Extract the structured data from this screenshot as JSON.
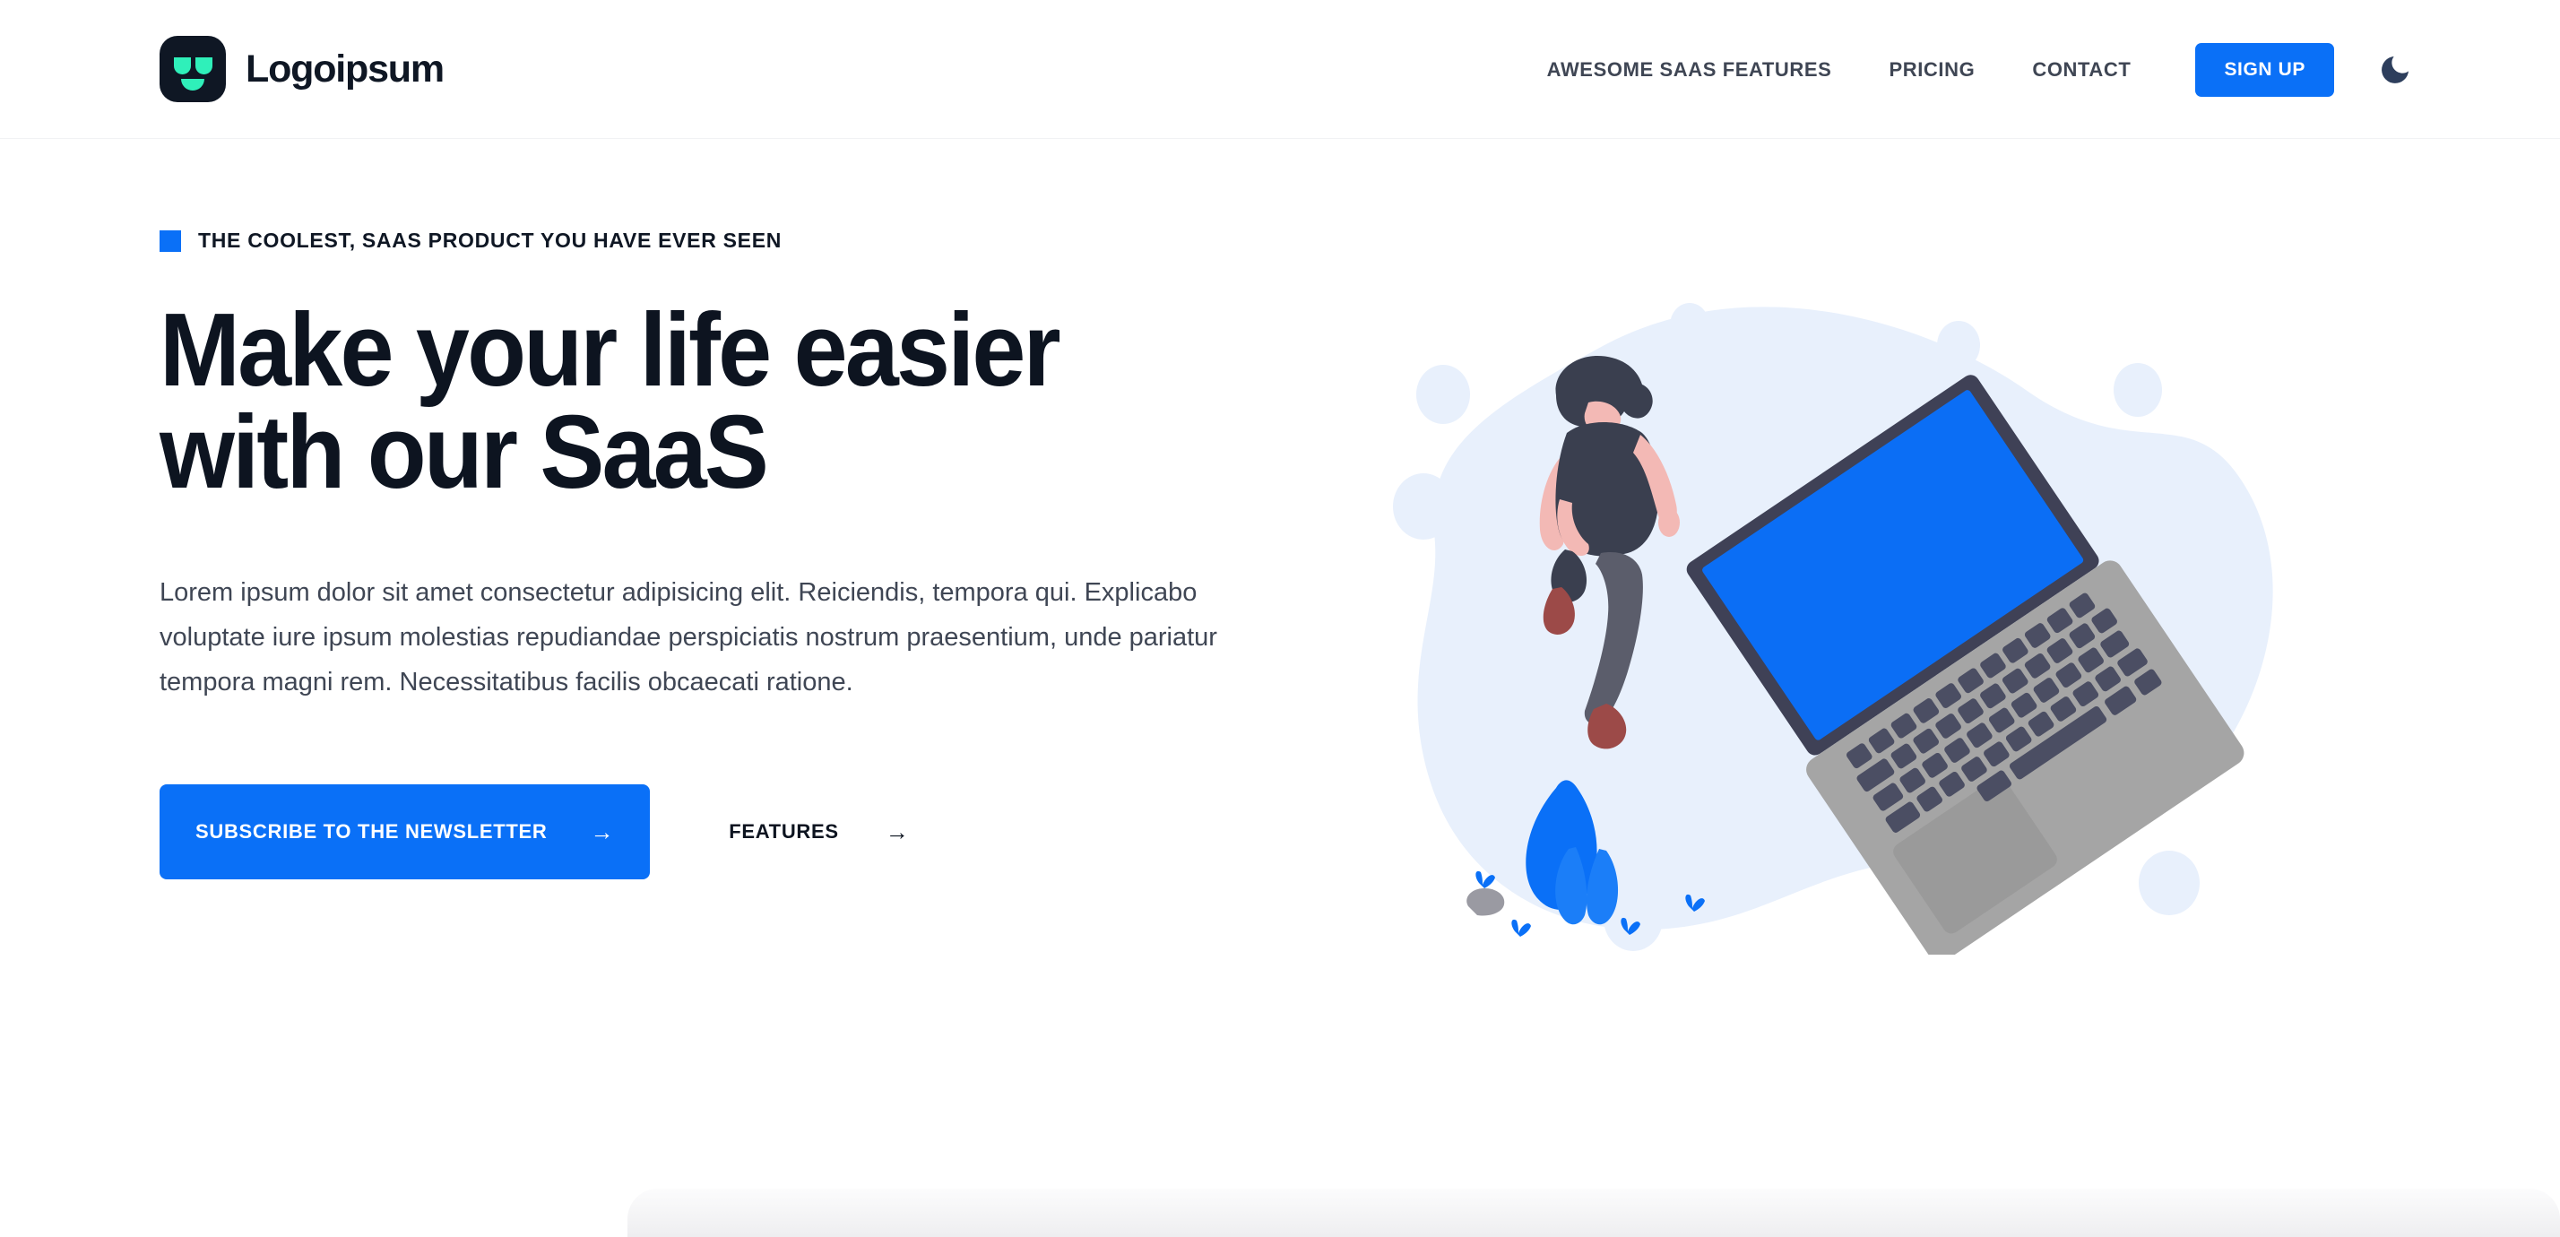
{
  "brand": {
    "name": "Logoipsum",
    "logo_icon": "robot-face-icon",
    "logo_bg": "#0f1724",
    "logo_accent": "#2ff0ba"
  },
  "nav": {
    "links": [
      {
        "label": "AWESOME SAAS FEATURES"
      },
      {
        "label": "PRICING"
      },
      {
        "label": "CONTACT"
      }
    ],
    "signup_label": "SIGN UP",
    "theme_toggle_icon": "moon-icon"
  },
  "hero": {
    "eyebrow": "THE COOLEST, SAAS PRODUCT YOU HAVE EVER SEEN",
    "headline": "Make your life easier with our SaaS",
    "lede": "Lorem ipsum dolor sit amet consectetur adipisicing elit. Reiciendis, tempora qui. Explicabo voluptate iure ipsum molestias repudiandae perspiciatis nostrum praesentium, unde pariatur tempora magni rem. Necessitatibus facilis obcaecati ratione.",
    "cta_primary": "SUBSCRIBE TO THE NEWSLETTER",
    "cta_primary_arrow": "→",
    "cta_secondary": "FEATURES",
    "cta_secondary_arrow": "→",
    "illustration_icon": "person-walking-with-laptop-illustration"
  },
  "colors": {
    "accent_blue": "#0a70f7",
    "screen_blue": "#0b6ef5",
    "ink": "#0d1420",
    "body_text": "#3f4654",
    "blob_light_blue": "#e8f0fc",
    "laptop_gray": "#a5a5a5",
    "laptop_bezel": "#3f4156",
    "skin": "#f3b9b5",
    "shirt": "#3a3f4f",
    "pants": "#5b5d6b",
    "shoes": "#9c4a48",
    "rock_gray": "#9a9aa2"
  }
}
